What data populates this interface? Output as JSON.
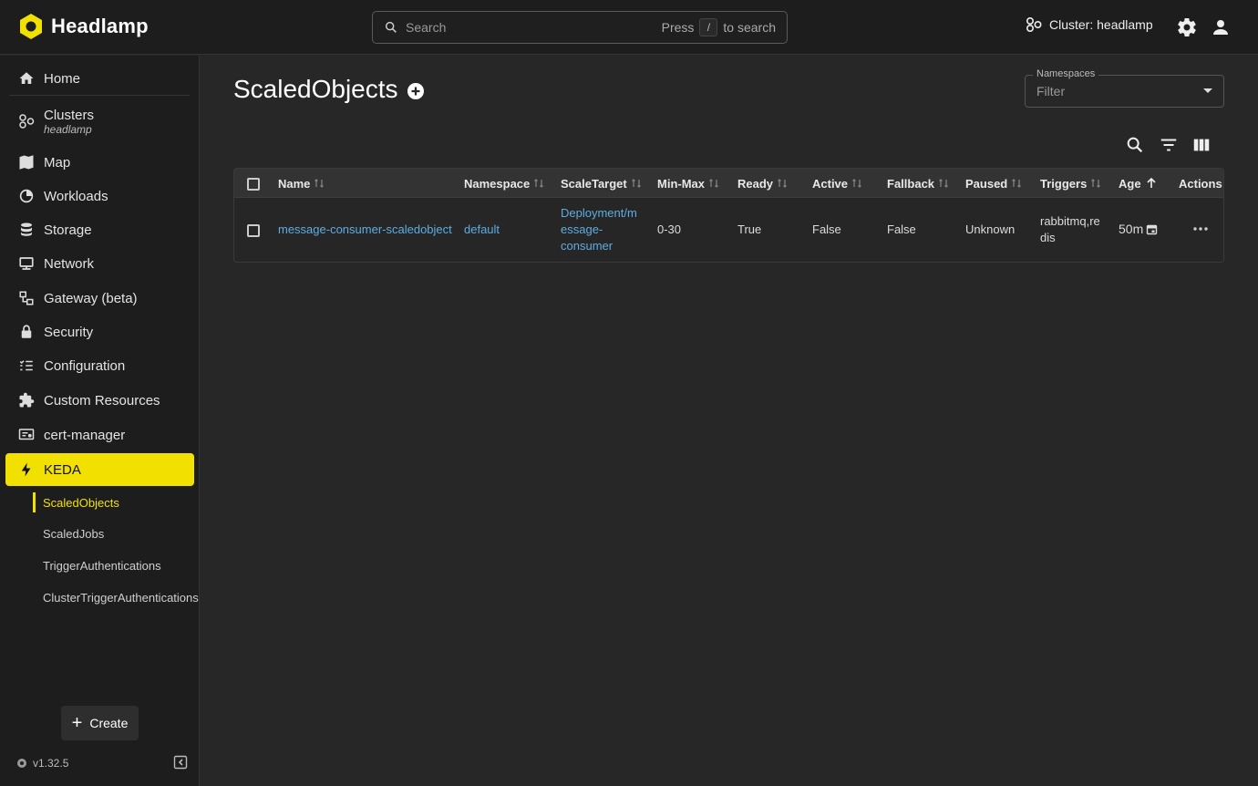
{
  "app": {
    "title": "Headlamp"
  },
  "search": {
    "placeholder": "Search",
    "hint_press": "Press",
    "hint_key": "/",
    "hint_suffix": "to search"
  },
  "cluster": {
    "label": "Cluster: headlamp"
  },
  "sidebar": {
    "items": [
      {
        "label": "Home",
        "icon": "home-icon"
      },
      {
        "label": "Clusters",
        "sub": "headlamp",
        "icon": "clusters-icon"
      },
      {
        "label": "Map",
        "icon": "map-icon"
      },
      {
        "label": "Workloads",
        "icon": "workloads-icon"
      },
      {
        "label": "Storage",
        "icon": "storage-icon"
      },
      {
        "label": "Network",
        "icon": "network-icon"
      },
      {
        "label": "Gateway (beta)",
        "icon": "gateway-icon"
      },
      {
        "label": "Security",
        "icon": "lock-icon"
      },
      {
        "label": "Configuration",
        "icon": "configuration-icon"
      },
      {
        "label": "Custom Resources",
        "icon": "puzzle-icon"
      },
      {
        "label": "cert-manager",
        "icon": "certificate-icon"
      },
      {
        "label": "KEDA",
        "icon": "lightning-icon",
        "active": true
      }
    ],
    "keda_subitems": [
      {
        "label": "ScaledObjects",
        "active": true
      },
      {
        "label": "ScaledJobs"
      },
      {
        "label": "TriggerAuthentications"
      },
      {
        "label": "ClusterTriggerAuthentications"
      }
    ],
    "create_label": "Create",
    "version": "v1.32.5"
  },
  "page": {
    "title": "ScaledObjects"
  },
  "namespaces": {
    "label": "Namespaces",
    "placeholder": "Filter"
  },
  "table": {
    "columns": [
      "Name",
      "Namespace",
      "ScaleTarget",
      "Min-Max",
      "Ready",
      "Active",
      "Fallback",
      "Paused",
      "Triggers",
      "Age",
      "Actions"
    ],
    "rows": [
      {
        "name": "message-consumer-scaledobject",
        "namespace": "default",
        "scale_target_line1": "Deployment/m",
        "scale_target_line2": "essage-",
        "scale_target_line3": "consumer",
        "min_max": "0-30",
        "ready": "True",
        "active": "False",
        "fallback": "False",
        "paused": "Unknown",
        "triggers_line1": "rabbitmq,re",
        "triggers_line2": "dis",
        "age": "50m"
      }
    ]
  },
  "colors": {
    "accent": "#f2e100",
    "link": "#5dade2",
    "background": "#272727",
    "sidebar": "#1d1d1d"
  }
}
